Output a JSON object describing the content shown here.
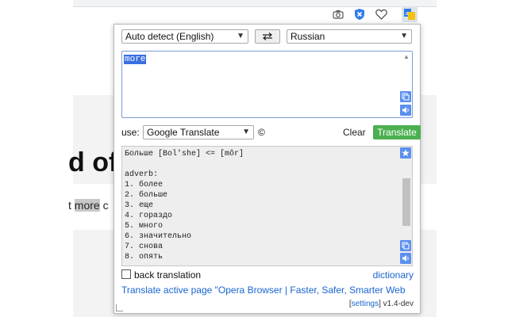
{
  "browser": {
    "icons": [
      "camera-icon",
      "shield-icon",
      "heart-icon",
      "translate-extension-icon"
    ]
  },
  "page": {
    "headline": "d of",
    "line_prefix": "t ",
    "line_highlight": "more",
    "line_suffix": " c"
  },
  "popup": {
    "source_language": "Auto detect (English)",
    "target_language": "Russian",
    "source_text": "more",
    "use_label": "use:",
    "engine": "Google Translate",
    "copyright": "©",
    "clear_label": "Clear",
    "translate_label": "Translate",
    "result_lines": [
      "Больше [Bol'she] <= [môr]",
      "",
      "adverb:",
      "1. более",
      "2. больше",
      "3. еще",
      "4. гораздо",
      "5. много",
      "6. значительно",
      "7. снова",
      "8. опять"
    ],
    "back_translation_label": "back translation",
    "dictionary_link": "dictionary",
    "translate_page_link": "Translate active page \"Opera Browser | Faster, Safer, Smarter Web",
    "settings_link": "settings",
    "version": "v1.4-dev"
  },
  "colors": {
    "translate_button": "#4caf50",
    "selection": "#3a6fe0",
    "link": "#1a64d0"
  }
}
